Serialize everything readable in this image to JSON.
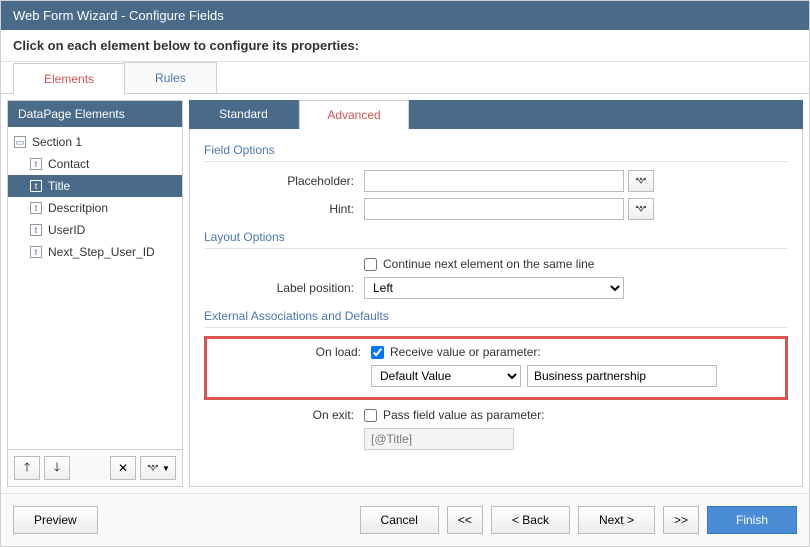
{
  "title": "Web Form Wizard - Configure Fields",
  "instruction": "Click on each element below to configure its properties:",
  "tabs": {
    "elements": "Elements",
    "rules": "Rules"
  },
  "left": {
    "header": "DataPage Elements",
    "section": "Section 1",
    "fields": [
      "Contact",
      "Title",
      "Descritpion",
      "UserID",
      "Next_Step_User_ID"
    ],
    "selected_index": 1
  },
  "subtabs": {
    "standard": "Standard",
    "advanced": "Advanced"
  },
  "sections": {
    "field_options": "Field Options",
    "layout_options": "Layout Options",
    "external": "External Associations and Defaults"
  },
  "labels": {
    "placeholder": "Placeholder:",
    "hint": "Hint:",
    "continue": "Continue next element on the same line",
    "label_position": "Label position:",
    "on_load": "On load:",
    "receive_value": "Receive value or parameter:",
    "on_exit": "On exit:",
    "pass_value": "Pass field value as parameter:"
  },
  "values": {
    "placeholder": "",
    "hint": "",
    "continue_checked": false,
    "label_position": "Left",
    "receive_value_checked": true,
    "load_type": "Default Value",
    "load_value": "Business partnership",
    "pass_value_checked": false,
    "exit_param": "[@Title]"
  },
  "footer": {
    "preview": "Preview",
    "cancel": "Cancel",
    "first": "<<",
    "back": "< Back",
    "next": "Next >",
    "last": ">>",
    "finish": "Finish"
  }
}
